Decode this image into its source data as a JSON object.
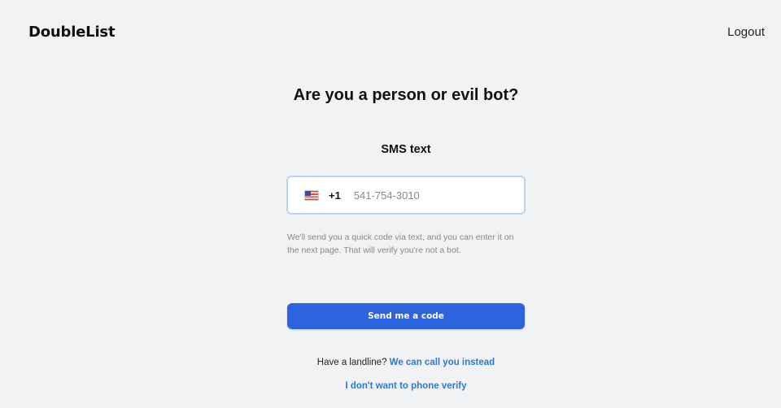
{
  "header": {
    "logo_text": "DoubleList",
    "logout_label": "Logout"
  },
  "main": {
    "title": "Are you a person or evil bot?",
    "method_label": "SMS text",
    "phone": {
      "country_flag": "us-flag-icon",
      "dial_code": "+1",
      "value": "",
      "placeholder": "541-754-3010"
    },
    "help_text": "We'll send you a quick code via text, and you can enter it on the next page. That will verify you're not a bot.",
    "send_button_label": "Send me a code",
    "landline_prompt": "Have a landline?",
    "call_link_label": "We can call you instead",
    "skip_link_label": "I don't want to phone verify"
  },
  "colors": {
    "background": "#f1f2f4",
    "primary_button": "#2e63e0",
    "link": "#2a7ad6",
    "input_focus_border": "#b9d3f0"
  }
}
